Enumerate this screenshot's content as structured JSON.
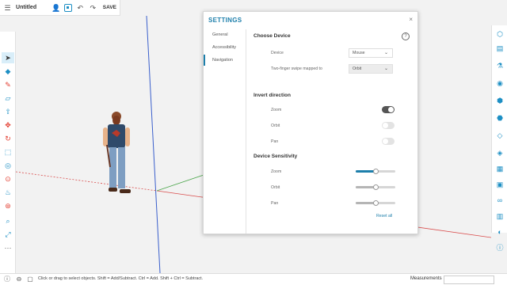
{
  "topbar": {
    "title": "Untitled",
    "save_label": "SAVE",
    "icons": [
      "menu-icon",
      "user-icon",
      "scenes-icon",
      "undo-icon",
      "redo-icon"
    ]
  },
  "left_toolbar": {
    "tools": [
      "search-icon",
      "select-icon",
      "eraser-icon",
      "pencil-icon",
      "rectangle-icon",
      "push-pull-icon",
      "move-icon",
      "rotate-icon",
      "scale-icon",
      "offset-icon",
      "tape-measure-icon",
      "paint-icon",
      "orbit-icon",
      "pan-icon",
      "zoom-icon",
      "zoom-extents-icon",
      "more-icon"
    ]
  },
  "right_toolbar": {
    "tools": [
      "entity-info-icon",
      "instructor-icon",
      "styles-icon",
      "materials-icon",
      "components-icon",
      "outliner-icon",
      "tags-icon",
      "scenes-panel-icon",
      "shadows-icon",
      "display-icon",
      "view-icon",
      "layers-icon",
      "soften-icon",
      "info-icon"
    ]
  },
  "settings": {
    "title": "SETTINGS",
    "close": "×",
    "nav": [
      {
        "label": "General",
        "active": false
      },
      {
        "label": "Accessibility",
        "active": false
      },
      {
        "label": "Navigation",
        "active": true
      }
    ],
    "choose_device": {
      "heading": "Choose Device",
      "help": "?",
      "device_label": "Device",
      "device_value": "Mouse",
      "swipe_label": "Two-finger swipe mapped to",
      "swipe_value": "Orbit"
    },
    "invert": {
      "heading": "Invert direction",
      "rows": [
        {
          "label": "Zoom",
          "on": true
        },
        {
          "label": "Orbit",
          "on": false
        },
        {
          "label": "Pan",
          "on": false
        }
      ]
    },
    "sensitivity": {
      "heading": "Device Sensitivity",
      "rows": [
        {
          "label": "Zoom",
          "value": 0.5,
          "active": true
        },
        {
          "label": "Orbit",
          "value": 0.5,
          "active": false
        },
        {
          "label": "Pan",
          "value": 0.5,
          "active": false
        }
      ],
      "reset_label": "Reset all"
    }
  },
  "statusbar": {
    "hint": "Click or drag to select objects. Shift = Add/Subtract. Ctrl = Add. Shift + Ctrl = Subtract.",
    "measurements_label": "Measurements",
    "measurements_value": "",
    "icons": [
      "info-status-icon",
      "user-status-icon",
      "pointer-status-icon"
    ]
  },
  "colors": {
    "accent": "#1d7fab",
    "toolbar_icon": "#1d8fc4",
    "axis_red": "#d94c4c",
    "axis_green": "#4aa54a",
    "axis_blue": "#3a5fcc"
  }
}
